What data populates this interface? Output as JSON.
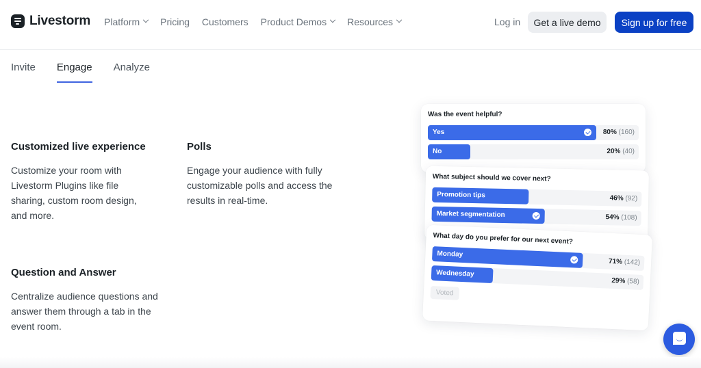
{
  "header": {
    "logo_text": "Livestorm",
    "nav": [
      {
        "label": "Platform",
        "has_dropdown": true
      },
      {
        "label": "Pricing",
        "has_dropdown": false
      },
      {
        "label": "Customers",
        "has_dropdown": false
      },
      {
        "label": "Product Demos",
        "has_dropdown": true
      },
      {
        "label": "Resources",
        "has_dropdown": true
      }
    ],
    "login_label": "Log in",
    "demo_label": "Get a live demo",
    "signup_label": "Sign up for free"
  },
  "tabs": [
    {
      "label": "Invite",
      "active": false
    },
    {
      "label": "Engage",
      "active": true
    },
    {
      "label": "Analyze",
      "active": false
    }
  ],
  "features": [
    {
      "title": "Customized live experience",
      "text": "Customize your room with Livestorm Plugins like file sharing, custom room design, and more."
    },
    {
      "title": "Polls",
      "text": "Engage your audience with fully customizable polls and access the results in real-time."
    },
    {
      "title": "Question and Answer",
      "text": "Centralize audience questions and answer them through a tab in the event room."
    }
  ],
  "polls": [
    {
      "question": "Was the event helpful?",
      "options": [
        {
          "label": "Yes",
          "percent": 80,
          "count": "(160)",
          "pct_label": "80%",
          "selected": true
        },
        {
          "label": "No",
          "percent": 20,
          "count": "(40)",
          "pct_label": "20%",
          "selected": false
        }
      ]
    },
    {
      "question": "What subject should we cover next?",
      "options": [
        {
          "label": "Promotion tips",
          "percent": 46,
          "count": "(92)",
          "pct_label": "46%",
          "selected": false
        },
        {
          "label": "Market segmentation",
          "percent": 54,
          "count": "(108)",
          "pct_label": "54%",
          "selected": true
        }
      ]
    },
    {
      "question": "What day do you prefer for our next event?",
      "options": [
        {
          "label": "Monday",
          "percent": 71,
          "count": "(142)",
          "pct_label": "71%",
          "selected": true
        },
        {
          "label": "Wednesday",
          "percent": 29,
          "count": "(58)",
          "pct_label": "29%",
          "selected": false
        }
      ],
      "voted_label": "Voted"
    }
  ],
  "chat_widget": {
    "icon": "chat-icon",
    "color": "#2c5be0"
  },
  "colors": {
    "brand": "#0b41c4",
    "poll_fill": "#3b6be8",
    "tab_underline": "#3f64e0"
  }
}
